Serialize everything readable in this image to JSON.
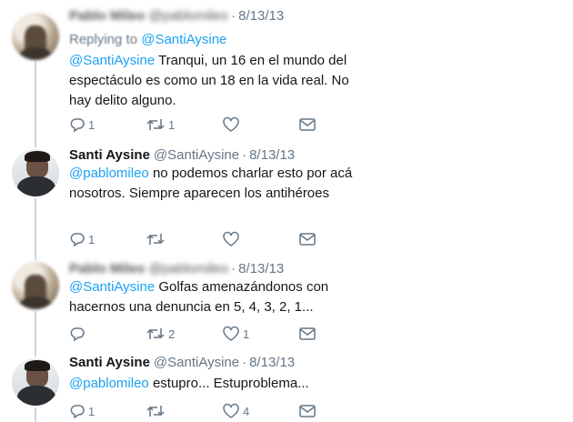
{
  "tweets": [
    {
      "name": "Pablo Mileo",
      "handle": "@pablomileo",
      "date": "8/13/13",
      "replying_label": "Replying to",
      "replying_handle": "@SantiAysine",
      "mention": "@SantiAysine",
      "text": " Tranqui, un 16 en el mundo del espectáculo es como un 18 en la vida real. No hay delito alguno.",
      "counts": {
        "reply": "1",
        "retweet": "1",
        "like": ""
      }
    },
    {
      "name": "Santi Aysine",
      "handle": "@SantiAysine",
      "date": "8/13/13",
      "mention": "@pablomileo",
      "text": " no podemos charlar esto por acá nosotros. Siempre aparecen los antihéroes",
      "counts": {
        "reply": "1",
        "retweet": "",
        "like": ""
      }
    },
    {
      "name": "Pablo Mileo",
      "handle": "@pablomileo",
      "date": "8/13/13",
      "mention": "@SantiAysine",
      "text": " Golfas amenazándonos con hacernos una denuncia en 5, 4, 3, 2, 1...",
      "counts": {
        "reply": "",
        "retweet": "2",
        "like": "1"
      }
    },
    {
      "name": "Santi Aysine",
      "handle": "@SantiAysine",
      "date": "8/13/13",
      "mention": "@pablomileo",
      "text": " estupro... Estuproblema...",
      "counts": {
        "reply": "1",
        "retweet": "",
        "like": "4"
      }
    }
  ],
  "separator": "·",
  "colors": {
    "link": "#1da1f2",
    "muted": "#657786",
    "text": "#14171a",
    "thread": "#ccd6dd"
  },
  "icons": [
    "reply-icon",
    "retweet-icon",
    "like-icon",
    "direct-message-icon"
  ]
}
